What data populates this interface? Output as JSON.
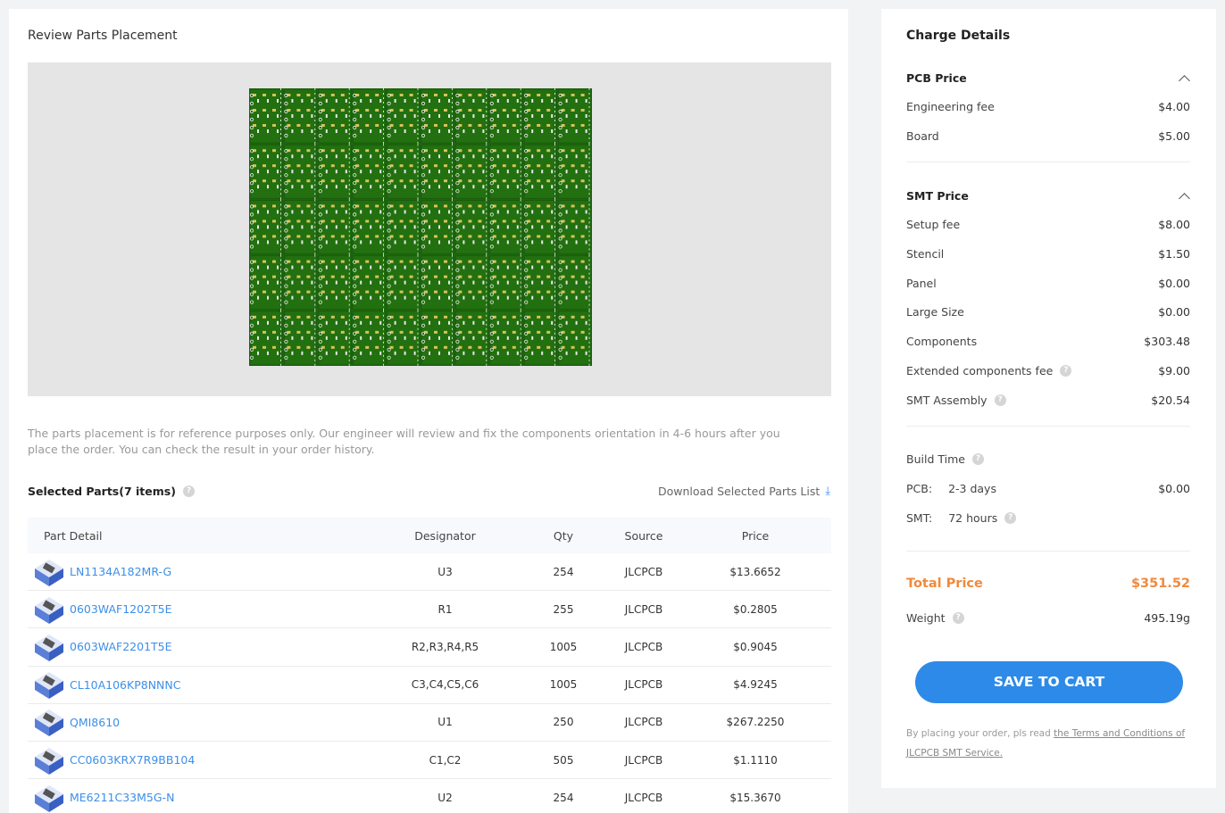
{
  "left": {
    "title": "Review Parts Placement",
    "notice": "The parts placement is for reference purposes only. Our engineer will review and fix the components orientation in 4-6 hours after you place the order. You can check the result in your order history.",
    "selected_title": "Selected Parts(7 items)",
    "download_label": "Download Selected Parts List",
    "headers": [
      "Part Detail",
      "Designator",
      "Qty",
      "Source",
      "Price"
    ],
    "parts": [
      {
        "name": "LN1134A182MR-G",
        "designator": "U3",
        "qty": "254",
        "source": "JLCPCB",
        "price": "$13.6652"
      },
      {
        "name": "0603WAF1202T5E",
        "designator": "R1",
        "qty": "255",
        "source": "JLCPCB",
        "price": "$0.2805"
      },
      {
        "name": "0603WAF2201T5E",
        "designator": "R2,R3,R4,R5",
        "qty": "1005",
        "source": "JLCPCB",
        "price": "$0.9045"
      },
      {
        "name": "CL10A106KP8NNNC",
        "designator": "C3,C4,C5,C6",
        "qty": "1005",
        "source": "JLCPCB",
        "price": "$4.9245"
      },
      {
        "name": "QMI8610",
        "designator": "U1",
        "qty": "250",
        "source": "JLCPCB",
        "price": "$267.2250"
      },
      {
        "name": "CC0603KRX7R9BB104",
        "designator": "C1,C2",
        "qty": "505",
        "source": "JLCPCB",
        "price": "$1.1110"
      },
      {
        "name": "ME6211C33M5G-N",
        "designator": "U2",
        "qty": "254",
        "source": "JLCPCB",
        "price": "$15.3670"
      }
    ]
  },
  "charge": {
    "title": "Charge Details",
    "pcb_price": "PCB Price",
    "engineering_fee": "Engineering fee",
    "engineering_fee_val": "$4.00",
    "board": "Board",
    "board_val": "$5.00",
    "smt_price": "SMT Price",
    "setup_fee": "Setup fee",
    "setup_fee_val": "$8.00",
    "stencil": "Stencil",
    "stencil_val": "$1.50",
    "panel": "Panel",
    "panel_val": "$0.00",
    "large_size": "Large Size",
    "large_size_val": "$0.00",
    "components": "Components",
    "components_val": "$303.48",
    "extended_fee": "Extended components fee",
    "extended_fee_val": "$9.00",
    "smt_assembly": "SMT Assembly",
    "smt_assembly_val": "$20.54",
    "build_time": "Build Time",
    "pcb_label": "PCB:",
    "pcb_days": "2-3 days",
    "pcb_time_val": "$0.00",
    "smt_label": "SMT:",
    "smt_hours": "72 hours",
    "total_label": "Total Price",
    "total_val": "$351.52",
    "weight_label": "Weight",
    "weight_val": "495.19g",
    "cart_button": "SAVE TO CART",
    "terms_prefix": "By placing your order, pls read ",
    "terms_link": "the Terms and Conditions of JLCPCB SMT Service."
  },
  "colors": {
    "accent": "#2d8ae8",
    "total": "#f08a3c",
    "pcb_green": "#1f6a12"
  }
}
